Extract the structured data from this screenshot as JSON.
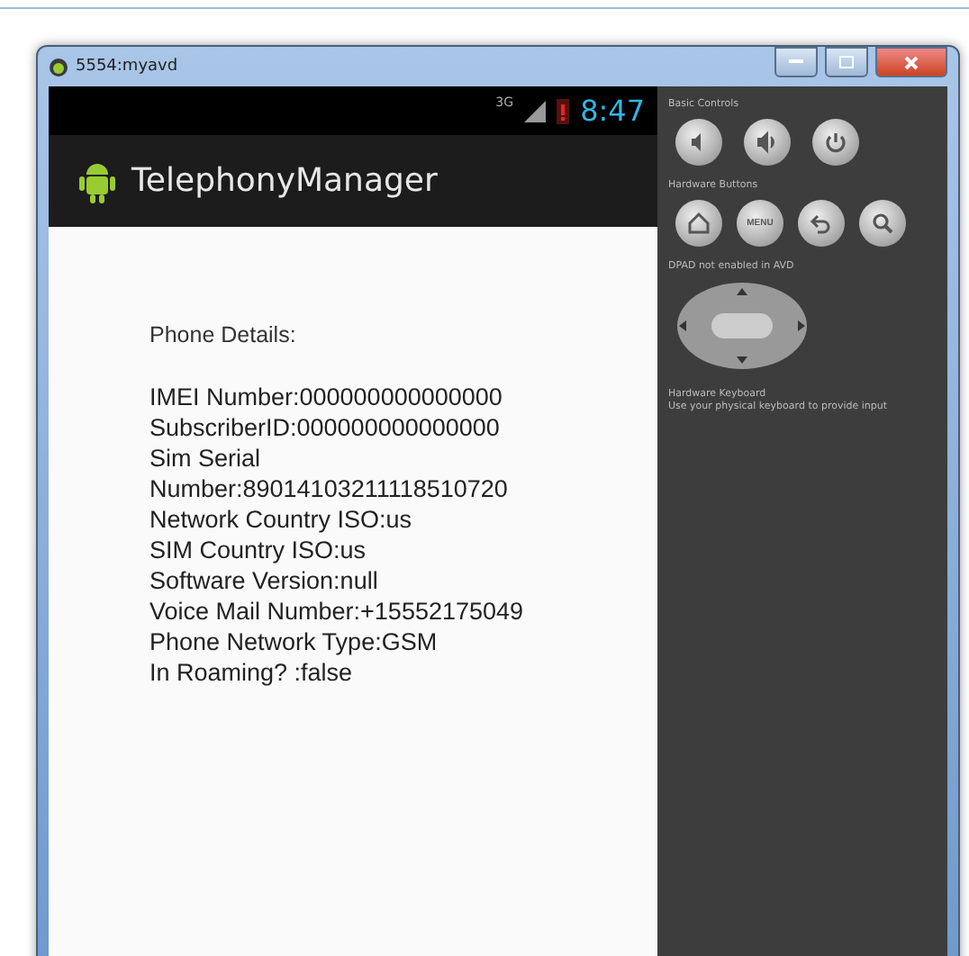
{
  "window": {
    "title": "5554:myavd"
  },
  "status_bar": {
    "network": "3G",
    "time": "8:47"
  },
  "action_bar": {
    "title": "TelephonyManager"
  },
  "content": {
    "heading": "Phone Details:",
    "lines": [
      "IMEI Number:000000000000000",
      "SubscriberID:000000000000000",
      "Sim Serial Number:89014103211118510720",
      "Network Country ISO:us",
      "SIM Country ISO:us",
      "Software Version:null",
      "Voice Mail Number:+15552175049",
      "Phone Network Type:GSM",
      "In Roaming? :false"
    ]
  },
  "controls": {
    "basic_label": "Basic Controls",
    "basic_buttons": [
      {
        "kind": "volume-down"
      },
      {
        "kind": "volume-up"
      },
      {
        "kind": "power"
      }
    ],
    "hardware_label": "Hardware Buttons",
    "hardware_buttons": [
      {
        "kind": "home"
      },
      {
        "kind": "menu",
        "label": "MENU"
      },
      {
        "kind": "back"
      },
      {
        "kind": "search"
      }
    ],
    "dpad_label": "DPAD not enabled in AVD",
    "keyboard_label": "Hardware Keyboard",
    "keyboard_hint": "Use your physical keyboard to provide input"
  }
}
